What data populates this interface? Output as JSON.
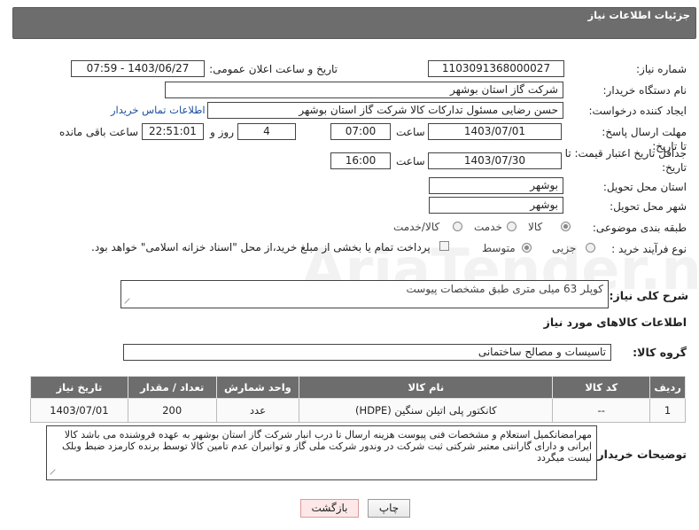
{
  "header": {
    "title": "جزئیات اطلاعات نیاز"
  },
  "fields": {
    "need_number_label": "شماره نیاز:",
    "need_number": "1103091368000027",
    "announce_label": "تاریخ و ساعت اعلان عمومی:",
    "announce_value": "1403/06/27 - 07:59",
    "buyer_org_label": "نام دستگاه خریدار:",
    "buyer_org": "شرکت گاز استان بوشهر",
    "creator_label": "ایجاد کننده درخواست:",
    "creator": "حسن رضایی مسئول تدارکات کالا شرکت گاز استان بوشهر",
    "contact_link": "اطلاعات تماس خریدار",
    "deadline_label": "مهلت ارسال پاسخ: تا تاریخ:",
    "deadline_date": "1403/07/01",
    "time_label": "ساعت",
    "deadline_time": "07:00",
    "days": "4",
    "days_label": "روز و",
    "remaining": "22:51:01",
    "remaining_label": "ساعت باقی مانده",
    "validity_label": "جداقل تاریخ اعتبار قیمت: تا تاریخ:",
    "validity_date": "1403/07/30",
    "validity_time": "16:00",
    "province_label": "استان محل تحویل:",
    "province": "بوشهر",
    "city_label": "شهر محل تحویل:",
    "city": "بوشهر",
    "category_label": "طبقه بندی موضوعی:",
    "category_options": [
      "کالا",
      "خدمت",
      "کالا/خدمت"
    ],
    "purchase_label": "نوع فرآیند خرید :",
    "purchase_options": [
      "جزیی",
      "متوسط"
    ],
    "payment_note": "پرداخت تمام یا بخشی از مبلغ خرید،از محل \"اسناد خزانه اسلامی\" خواهد بود."
  },
  "description": {
    "label": "شرح کلی نیاز:",
    "value": "کوپلر 63 میلی متری طبق مشخصات پیوست"
  },
  "goods_section": {
    "title": "اطلاعات کالاهای مورد نیاز",
    "group_label": "گروه کالا:",
    "group_value": "تاسیسات و مصالح ساختمانی"
  },
  "table": {
    "headers": [
      "ردیف",
      "کد کالا",
      "نام کالا",
      "واحد شمارش",
      "تعداد / مقدار",
      "تاریخ نیاز"
    ],
    "rows": [
      [
        "1",
        "--",
        "کانکتور پلی اتیلن سنگین (HDPE)",
        "عدد",
        "200",
        "1403/07/01"
      ]
    ]
  },
  "buyer_notes": {
    "label": "توضیحات خریدار:",
    "value": "مهرامضاتکمیل استعلام و مشخصات فنی پیوست هزینه ارسال تا درب انبار شرکت گاز استان بوشهر به عهده فروشنده می باشد کالا ایرانی و دارای گارانتی معتبر شرکتی ثبت شرکت در وندور شرکت ملی گاز و توانیران عدم تامین کالا توسط برنده کارمزد ضبط وبلک لیست میگردد"
  },
  "buttons": {
    "print": "چاپ",
    "back": "بازگشت"
  },
  "watermark": "AriaTender.neT"
}
